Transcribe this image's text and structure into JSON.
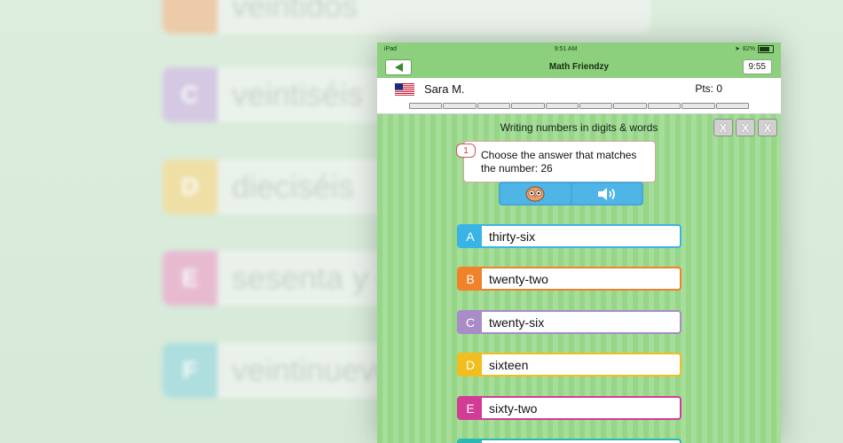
{
  "background": {
    "rows": [
      {
        "letter": "",
        "text": "veintidós",
        "color": "#f0c49f"
      },
      {
        "letter": "C",
        "text": "veintiséis",
        "color": "#d3c2e4"
      },
      {
        "letter": "D",
        "text": "dieciséis",
        "color": "#f3dd9c"
      },
      {
        "letter": "E",
        "text": "sesenta y dos",
        "color": "#eab2cf"
      },
      {
        "letter": "F",
        "text": "veintinueve",
        "color": "#a7dce0"
      }
    ]
  },
  "status": {
    "device": "iPad",
    "time": "9:51 AM",
    "battery": "82%"
  },
  "nav": {
    "title": "Math Friendzy",
    "timer": "9:55"
  },
  "player": {
    "name": "Sara M.",
    "points": "Pts: 0"
  },
  "quiz": {
    "heading": "Writing numbers in digits & words",
    "x_marks": [
      "X",
      "X",
      "X"
    ],
    "question_number": "1",
    "question": "Choose the answer that matches the number: 26",
    "answers": [
      {
        "letter": "A",
        "text": "thirty-six",
        "color": "#39b4e6"
      },
      {
        "letter": "B",
        "text": "twenty-two",
        "color": "#f0822c"
      },
      {
        "letter": "C",
        "text": "twenty-six",
        "color": "#a98bc8"
      },
      {
        "letter": "D",
        "text": "sixteen",
        "color": "#f1bd1f"
      },
      {
        "letter": "E",
        "text": "sixty-two",
        "color": "#d23c95"
      }
    ]
  }
}
